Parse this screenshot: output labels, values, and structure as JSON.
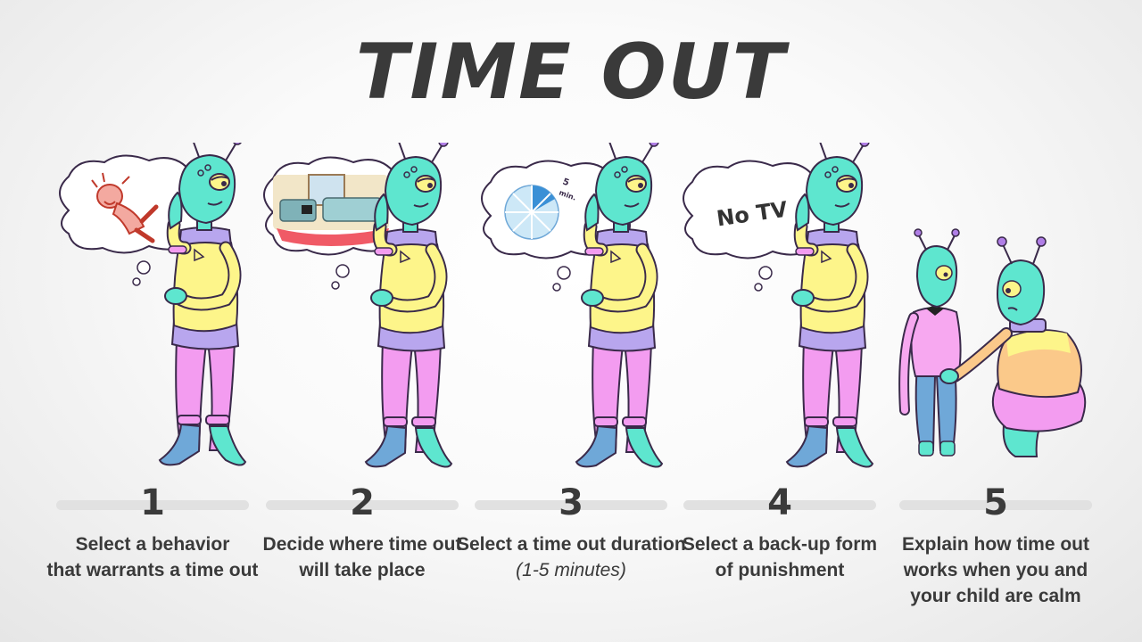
{
  "title": "TIME OUT",
  "steps": [
    {
      "number": "1",
      "lines": [
        "Select a behavior",
        "that warrants a time out"
      ],
      "thought": "tantrum"
    },
    {
      "number": "2",
      "lines": [
        "Decide where time out",
        "will take place"
      ],
      "thought": "living-room"
    },
    {
      "number": "3",
      "lines": [
        "Select a time out duration"
      ],
      "note": "(1-5 minutes)",
      "thought": "timer",
      "timer_label_top": "5",
      "timer_label_bottom": "min."
    },
    {
      "number": "4",
      "lines": [
        "Select a back-up form",
        "of punishment"
      ],
      "thought": "no-tv",
      "thought_text": "No TV"
    },
    {
      "number": "5",
      "lines": [
        "Explain how time out",
        "works when you and",
        "your child are calm"
      ],
      "thought": "none"
    }
  ],
  "colors": {
    "skin": "#5ee6cf",
    "shirt": "#fdf58a",
    "pants": "#f39cf0",
    "collar": "#b8a6ee",
    "boots": "#6fa8d8",
    "text": "#3a3a3a",
    "antenna_tip": "#b07ee6"
  }
}
